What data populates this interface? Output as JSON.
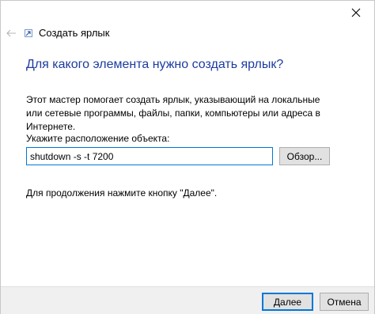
{
  "window": {
    "title": "Создать ярлык",
    "close_icon": "close-icon",
    "back_icon": "back-arrow-icon",
    "app_icon": "shortcut-icon"
  },
  "page": {
    "heading": "Для какого элемента нужно создать ярлык?",
    "description": "Этот мастер помогает создать ярлык, указывающий на локальные или сетевые программы, файлы, папки, компьютеры или адреса в Интернете.",
    "location_label": "Укажите расположение объекта:",
    "location_value": "shutdown -s -t 7200",
    "browse_label": "Обзор...",
    "hint": "Для продолжения нажмите кнопку \"Далее\"."
  },
  "footer": {
    "next_label": "Далее",
    "cancel_label": "Отмена"
  },
  "colors": {
    "heading": "#1d3c9f",
    "accent": "#0078d7",
    "footer_bg": "#f0f0f0"
  }
}
